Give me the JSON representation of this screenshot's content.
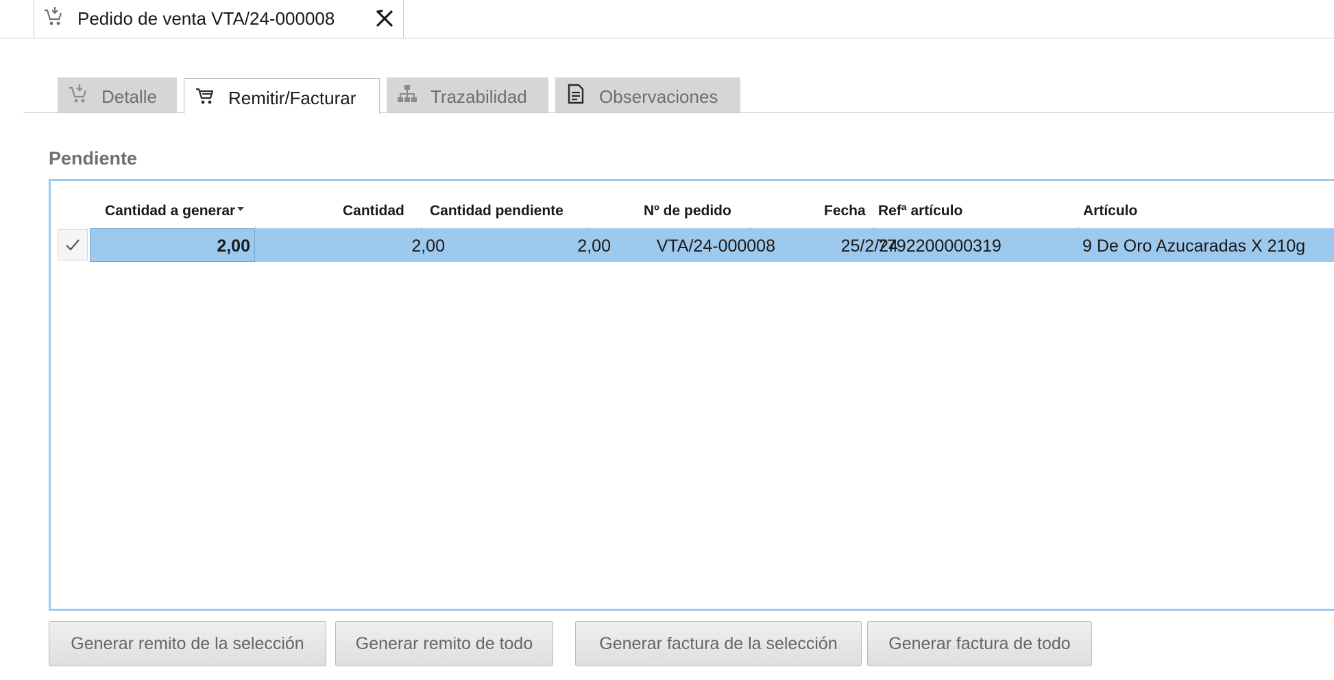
{
  "document_tab": {
    "title": "Pedido de venta VTA/24-000008",
    "icon": "cart-download-icon",
    "close_icon": "close-icon"
  },
  "section_tabs": [
    {
      "label": "Detalle",
      "icon": "cart-download-icon",
      "active": false
    },
    {
      "label": "Remitir/Facturar",
      "icon": "cart-icon",
      "active": true
    },
    {
      "label": "Trazabilidad",
      "icon": "hierarchy-icon",
      "active": false
    },
    {
      "label": "Observaciones",
      "icon": "document-icon",
      "active": false
    }
  ],
  "pending": {
    "title": "Pendiente",
    "columns": [
      "Cantidad a generar",
      "Cantidad",
      "Cantidad pendiente",
      "Nº de pedido",
      "Fecha",
      "Refª artículo",
      "Artículo"
    ],
    "rows": [
      {
        "selected": true,
        "cantidad_a_generar": "2,00",
        "cantidad": "2,00",
        "cantidad_pendiente": "2,00",
        "nro_pedido": "VTA/24-000008",
        "fecha": "25/2/24",
        "ref_articulo": "7792200000319",
        "articulo": "9 De Oro Azucaradas X 210g"
      }
    ]
  },
  "buttons": {
    "remito_seleccion": "Generar remito de la selección",
    "remito_todo": "Generar remito de todo",
    "factura_seleccion": "Generar factura de la selección",
    "factura_todo": "Generar factura de todo"
  },
  "colors": {
    "selection": "#9ec9ee",
    "tab_inactive": "#d6d6d6",
    "muted_text": "#6f6f6f"
  }
}
